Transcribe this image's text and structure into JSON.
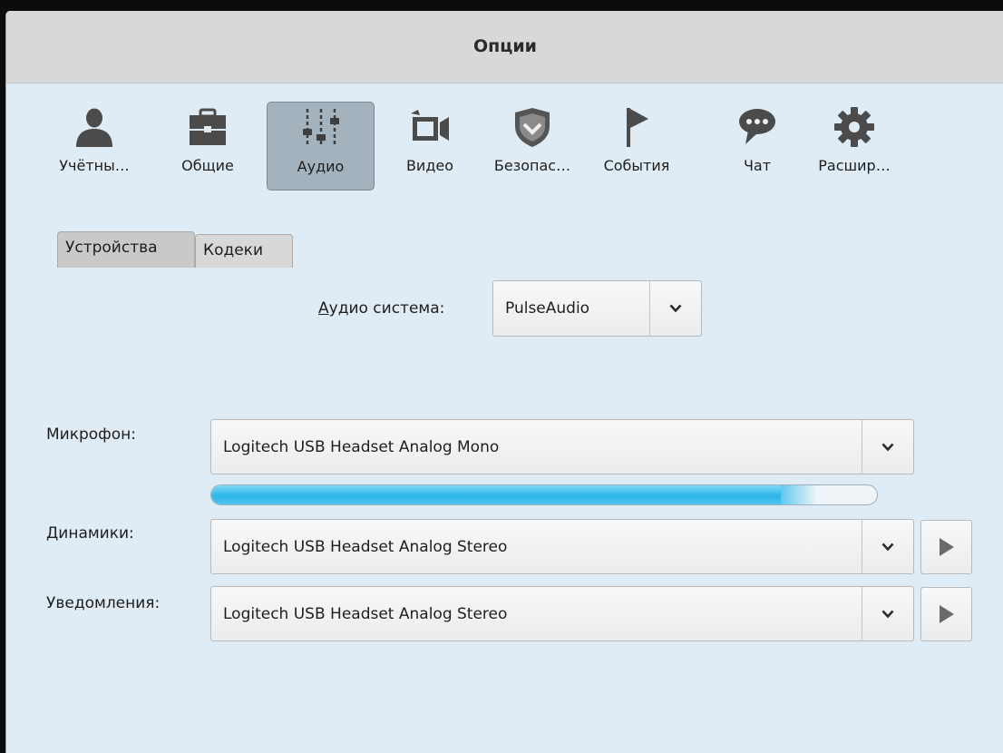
{
  "window": {
    "title": "Опции"
  },
  "toolbar": {
    "items": [
      {
        "label": "Учётны…",
        "icon": "user-icon",
        "active": false
      },
      {
        "label": "Общие",
        "icon": "briefcase-icon",
        "active": false
      },
      {
        "label": "Аудио",
        "icon": "equalizer-icon",
        "active": true
      },
      {
        "label": "Видео",
        "icon": "video-camera-icon",
        "active": false
      },
      {
        "label": "Безопас…",
        "icon": "shield-icon",
        "active": false
      },
      {
        "label": "События",
        "icon": "flag-icon",
        "active": false
      },
      {
        "label": "Чат",
        "icon": "chat-bubble-icon",
        "active": false
      },
      {
        "label": "Расшир…",
        "icon": "gear-icon",
        "active": false
      }
    ]
  },
  "tabs": [
    {
      "label": "Устройства",
      "active": true
    },
    {
      "label": "Кодеки",
      "active": false
    }
  ],
  "audio_system": {
    "label_mnemonic": "А",
    "label_rest": "удио система:",
    "value": "PulseAudio"
  },
  "microphone": {
    "label": "Микрофон:",
    "value": "Logitech USB Headset Analog Mono",
    "level_fraction": 0.91
  },
  "speakers": {
    "label": "Динамики:",
    "value": "Logitech USB Headset Analog Stereo"
  },
  "notifications": {
    "label": "Уведомления:",
    "value": "Logitech USB Headset Analog Stereo"
  },
  "colors": {
    "window_bg": "#e0ecf5",
    "titlebar_bg": "#d8d8d8",
    "level_accent": "#2bb5e8",
    "active_toolbar_bg": "#a4b2bd"
  }
}
